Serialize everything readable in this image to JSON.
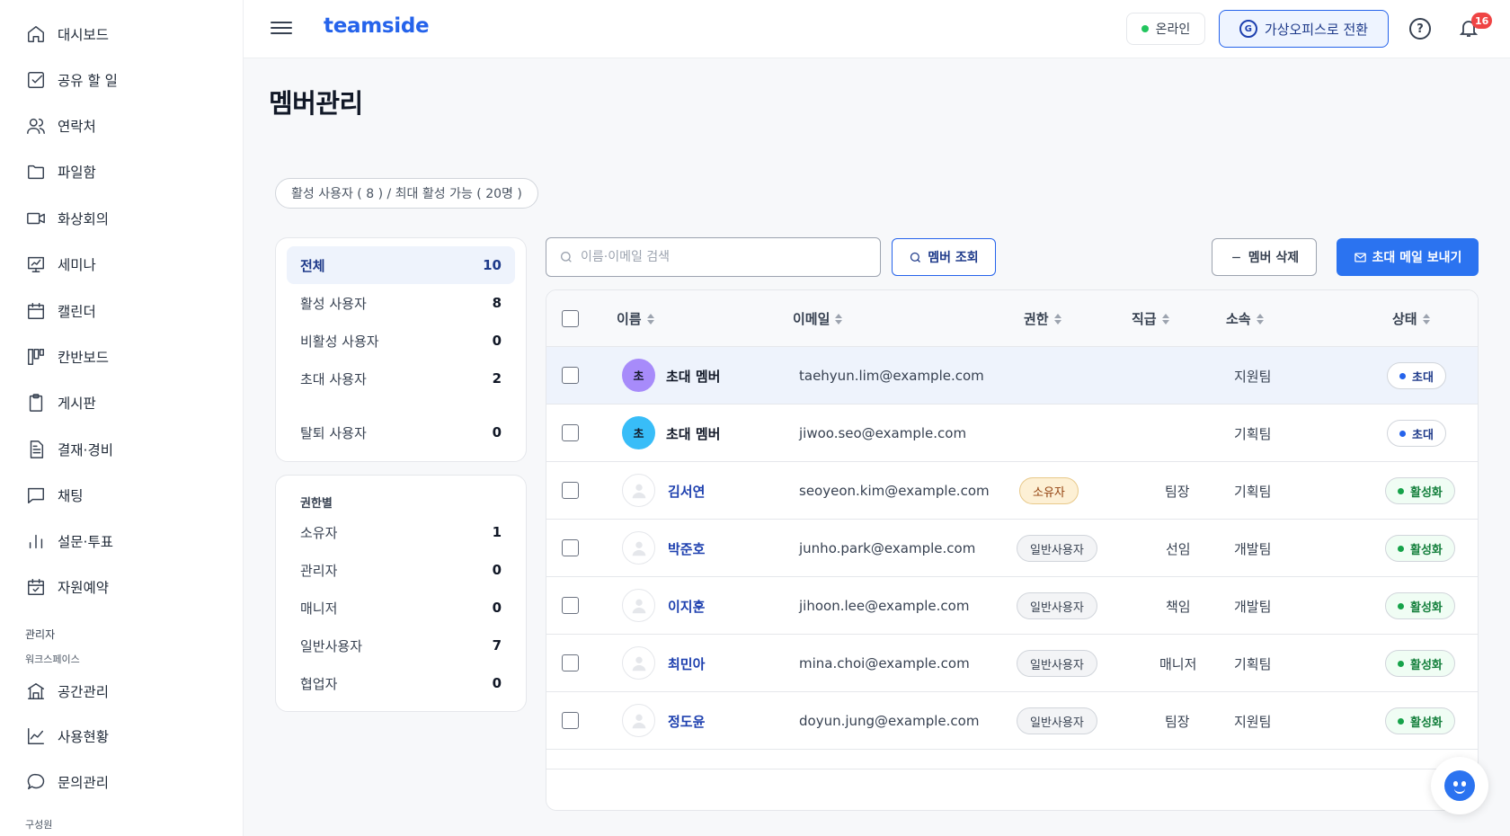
{
  "app": {
    "brand": "teamside"
  },
  "sidebar": {
    "items": [
      {
        "label": "대시보드",
        "icon": "home-icon"
      },
      {
        "label": "공유 할 일",
        "icon": "checkbox-icon"
      },
      {
        "label": "연락처",
        "icon": "users-icon"
      },
      {
        "label": "파일함",
        "icon": "folder-icon"
      },
      {
        "label": "화상회의",
        "icon": "video-icon"
      },
      {
        "label": "세미나",
        "icon": "presentation-icon"
      },
      {
        "label": "캘린더",
        "icon": "calendar-icon"
      },
      {
        "label": "칸반보드",
        "icon": "kanban-icon"
      },
      {
        "label": "게시판",
        "icon": "clipboard-icon"
      },
      {
        "label": "결재·경비",
        "icon": "document-icon"
      },
      {
        "label": "채팅",
        "icon": "chat-icon"
      },
      {
        "label": "설문·투표",
        "icon": "bar-chart-icon"
      },
      {
        "label": "자원예약",
        "icon": "calendar-check-icon"
      }
    ],
    "admin_section": "관리자",
    "workspace_section": "워크스페이스",
    "admin_items": [
      {
        "label": "공간관리",
        "icon": "building-icon"
      },
      {
        "label": "사용현황",
        "icon": "line-chart-icon"
      },
      {
        "label": "문의관리",
        "icon": "speech-bubble-icon"
      }
    ],
    "members_section": "구성원"
  },
  "header": {
    "status": "온라인",
    "virtual_office_button": "가상오피스로 전환",
    "notification_count": "16"
  },
  "page": {
    "title": "멤버관리",
    "usage_summary": "활성 사용자 ( 8 ) / 최대 활성 가능 ( 20명 )"
  },
  "filters": {
    "status": [
      {
        "label": "전체",
        "count": "10"
      },
      {
        "label": "활성 사용자",
        "count": "8"
      },
      {
        "label": "비활성 사용자",
        "count": "0"
      },
      {
        "label": "초대 사용자",
        "count": "2"
      },
      {
        "label": "탈퇴 사용자",
        "count": "0"
      }
    ],
    "roles_title": "권한별",
    "roles": [
      {
        "label": "소유자",
        "count": "1"
      },
      {
        "label": "관리자",
        "count": "0"
      },
      {
        "label": "매니저",
        "count": "0"
      },
      {
        "label": "일반사용자",
        "count": "7"
      },
      {
        "label": "협업자",
        "count": "0"
      }
    ]
  },
  "toolbar": {
    "search_placeholder": "이름·이메일 검색",
    "lookup_button": "멤버 조회",
    "delete_button": "멤버 삭제",
    "invite_button": "초대 메일 보내기"
  },
  "table": {
    "columns": [
      "이름",
      "이메일",
      "권한",
      "직급",
      "소속",
      "상태"
    ],
    "rows": [
      {
        "avatar": "초",
        "avatar_color": "#a78bfa",
        "name": "초대 멤버",
        "email": "taehyun.lim@example.com",
        "role": "",
        "title": "",
        "team": "지원팀",
        "status": "초대"
      },
      {
        "avatar": "초",
        "avatar_color": "#38bdf8",
        "name": "초대 멤버",
        "email": "jiwoo.seo@example.com",
        "role": "",
        "title": "",
        "team": "기획팀",
        "status": "초대"
      },
      {
        "avatar": "",
        "name": "김서연",
        "email": "seoyeon.kim@example.com",
        "role": "소유자",
        "title": "팀장",
        "team": "기획팀",
        "status": "활성화"
      },
      {
        "avatar": "",
        "name": "박준호",
        "email": "junho.park@example.com",
        "role": "일반사용자",
        "title": "선임",
        "team": "개발팀",
        "status": "활성화"
      },
      {
        "avatar": "",
        "name": "이지훈",
        "email": "jihoon.lee@example.com",
        "role": "일반사용자",
        "title": "책임",
        "team": "개발팀",
        "status": "활성화"
      },
      {
        "avatar": "",
        "name": "최민아",
        "email": "mina.choi@example.com",
        "role": "일반사용자",
        "title": "매니저",
        "team": "기획팀",
        "status": "활성화"
      },
      {
        "avatar": "",
        "name": "정도윤",
        "email": "doyun.jung@example.com",
        "role": "일반사용자",
        "title": "팀장",
        "team": "지원팀",
        "status": "활성화"
      }
    ]
  },
  "colors": {
    "accent": "#2b73f0",
    "brand": "#2563eb",
    "active_status": "#16a34a",
    "invite_status": "#2563eb"
  }
}
